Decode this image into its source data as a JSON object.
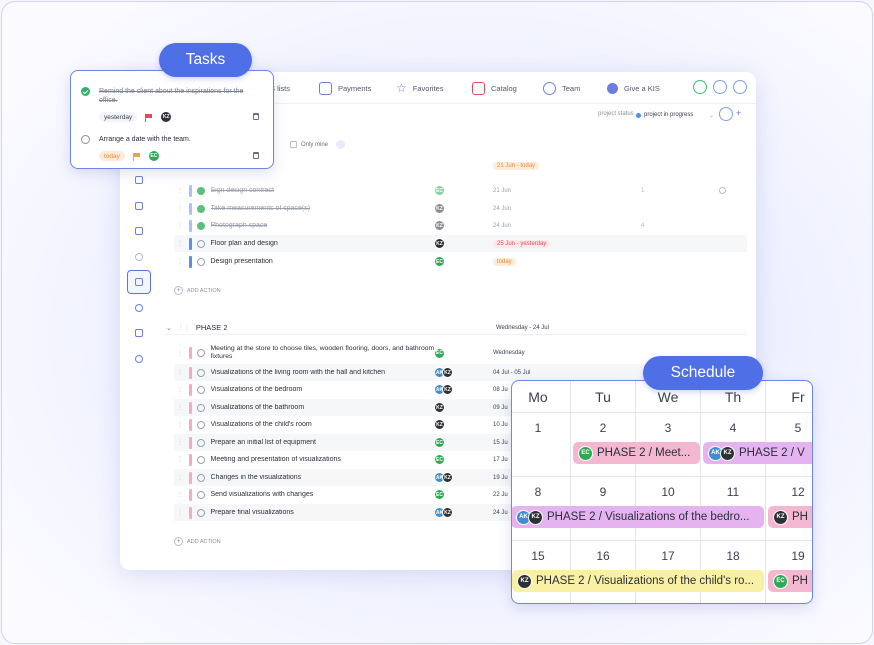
{
  "nav": {
    "lists_fragment": "S lists",
    "payments": "Payments",
    "favorites": "Favorites",
    "catalog": "Catalog",
    "team": "Team",
    "give_kis": "Give a KIS"
  },
  "subbar": {
    "status_label": "project status",
    "status_value": "project in progress"
  },
  "filter": {
    "only_mine": "Only mine"
  },
  "phase1": {
    "head_date": "21 Jun - today",
    "rows": [
      {
        "name": "Sign design contract",
        "done": true,
        "av": [
          "EC"
        ],
        "date": "21 Jun",
        "meta": "1"
      },
      {
        "name": "Take measurements of space(s)",
        "done": true,
        "av": [
          "KZ"
        ],
        "date": "24 Jun",
        "meta": ""
      },
      {
        "name": "Photograph space",
        "done": true,
        "av": [
          "KZ"
        ],
        "date": "24 Jun",
        "meta": "4"
      },
      {
        "name": "Floor plan and design",
        "done": false,
        "av": [
          "KZ"
        ],
        "date": "25 Jun - yesterday",
        "meta": ""
      },
      {
        "name": "Design presentation",
        "done": false,
        "av": [
          "EC"
        ],
        "date": "today",
        "meta": ""
      }
    ],
    "add_action": "ADD ACTION"
  },
  "phase2": {
    "title": "PHASE 2",
    "date": "Wednesday - 24 Jul",
    "rows": [
      {
        "name": "Meeting at the store to choose tiles, wooden flooring, doors, and bathroom fixtures",
        "av": [
          "EC"
        ],
        "date": "Wednesday"
      },
      {
        "name": "Visualizations of the living room with the hall and kitchen",
        "av": [
          "AK",
          "KZ"
        ],
        "date": "04 Jul - 05 Jul"
      },
      {
        "name": "Visualizations of the bedroom",
        "av": [
          "AK",
          "KZ"
        ],
        "date": "08 Ju"
      },
      {
        "name": "Visualizations of the bathroom",
        "av": [
          "KZ"
        ],
        "date": "09 Ju"
      },
      {
        "name": "Visualizations of the child's room",
        "av": [
          "KZ"
        ],
        "date": "10 Ju"
      },
      {
        "name": "Prepare an initial list of equipment",
        "av": [
          "EC"
        ],
        "date": "15 Ju"
      },
      {
        "name": "Meeting and presentation of visualizations",
        "av": [
          "EC"
        ],
        "date": "17 Ju"
      },
      {
        "name": "Changes in the visualizations",
        "av": [
          "AK",
          "KZ"
        ],
        "date": "19 Ju"
      },
      {
        "name": "Send visualizations with changes",
        "av": [
          "EC"
        ],
        "date": "22 Ju"
      },
      {
        "name": "Prepare final visualizations",
        "av": [
          "AK",
          "KZ"
        ],
        "date": "24 Ju"
      }
    ],
    "add_action": "ADD ACTION"
  },
  "tasks": {
    "tag": "Tasks",
    "items": [
      {
        "title": "Remind the client about the inspirations for the office.",
        "done": true,
        "when": "yesterday",
        "av": "KZ"
      },
      {
        "title": "Arrange a date with the team.",
        "done": false,
        "when": "today",
        "av": "EC"
      }
    ]
  },
  "schedule": {
    "tag": "Schedule",
    "days": [
      "Mo",
      "Tu",
      "We",
      "Th",
      "Fr"
    ],
    "weeks": [
      [
        "1",
        "2",
        "3",
        "4",
        "5"
      ],
      [
        "8",
        "9",
        "10",
        "11",
        "12"
      ],
      [
        "15",
        "16",
        "17",
        "18",
        "19"
      ]
    ],
    "events": [
      {
        "label": "PHASE 2 / Meet...",
        "av": [
          "EC"
        ]
      },
      {
        "label": "PHASE 2 / V",
        "av": [
          "AK",
          "KZ"
        ]
      },
      {
        "label": "PHASE 2 / Visualizations of the bedro...",
        "av": [
          "AK",
          "KZ"
        ]
      },
      {
        "label": "PH",
        "av": [
          "KZ"
        ]
      },
      {
        "label": "PHASE 2 / Visualizations of the child's ro...",
        "av": [
          "KZ"
        ]
      },
      {
        "label": "PH",
        "av": [
          "EC"
        ]
      }
    ]
  },
  "colors": {
    "accent": "#4f6fe6",
    "phase1_bar": "#5b8ee8",
    "phase2_bar": "#f4a9c4",
    "done_green": "#5bc17a",
    "overdue_red": "#e24a58",
    "today_orange": "#e98a3b"
  }
}
